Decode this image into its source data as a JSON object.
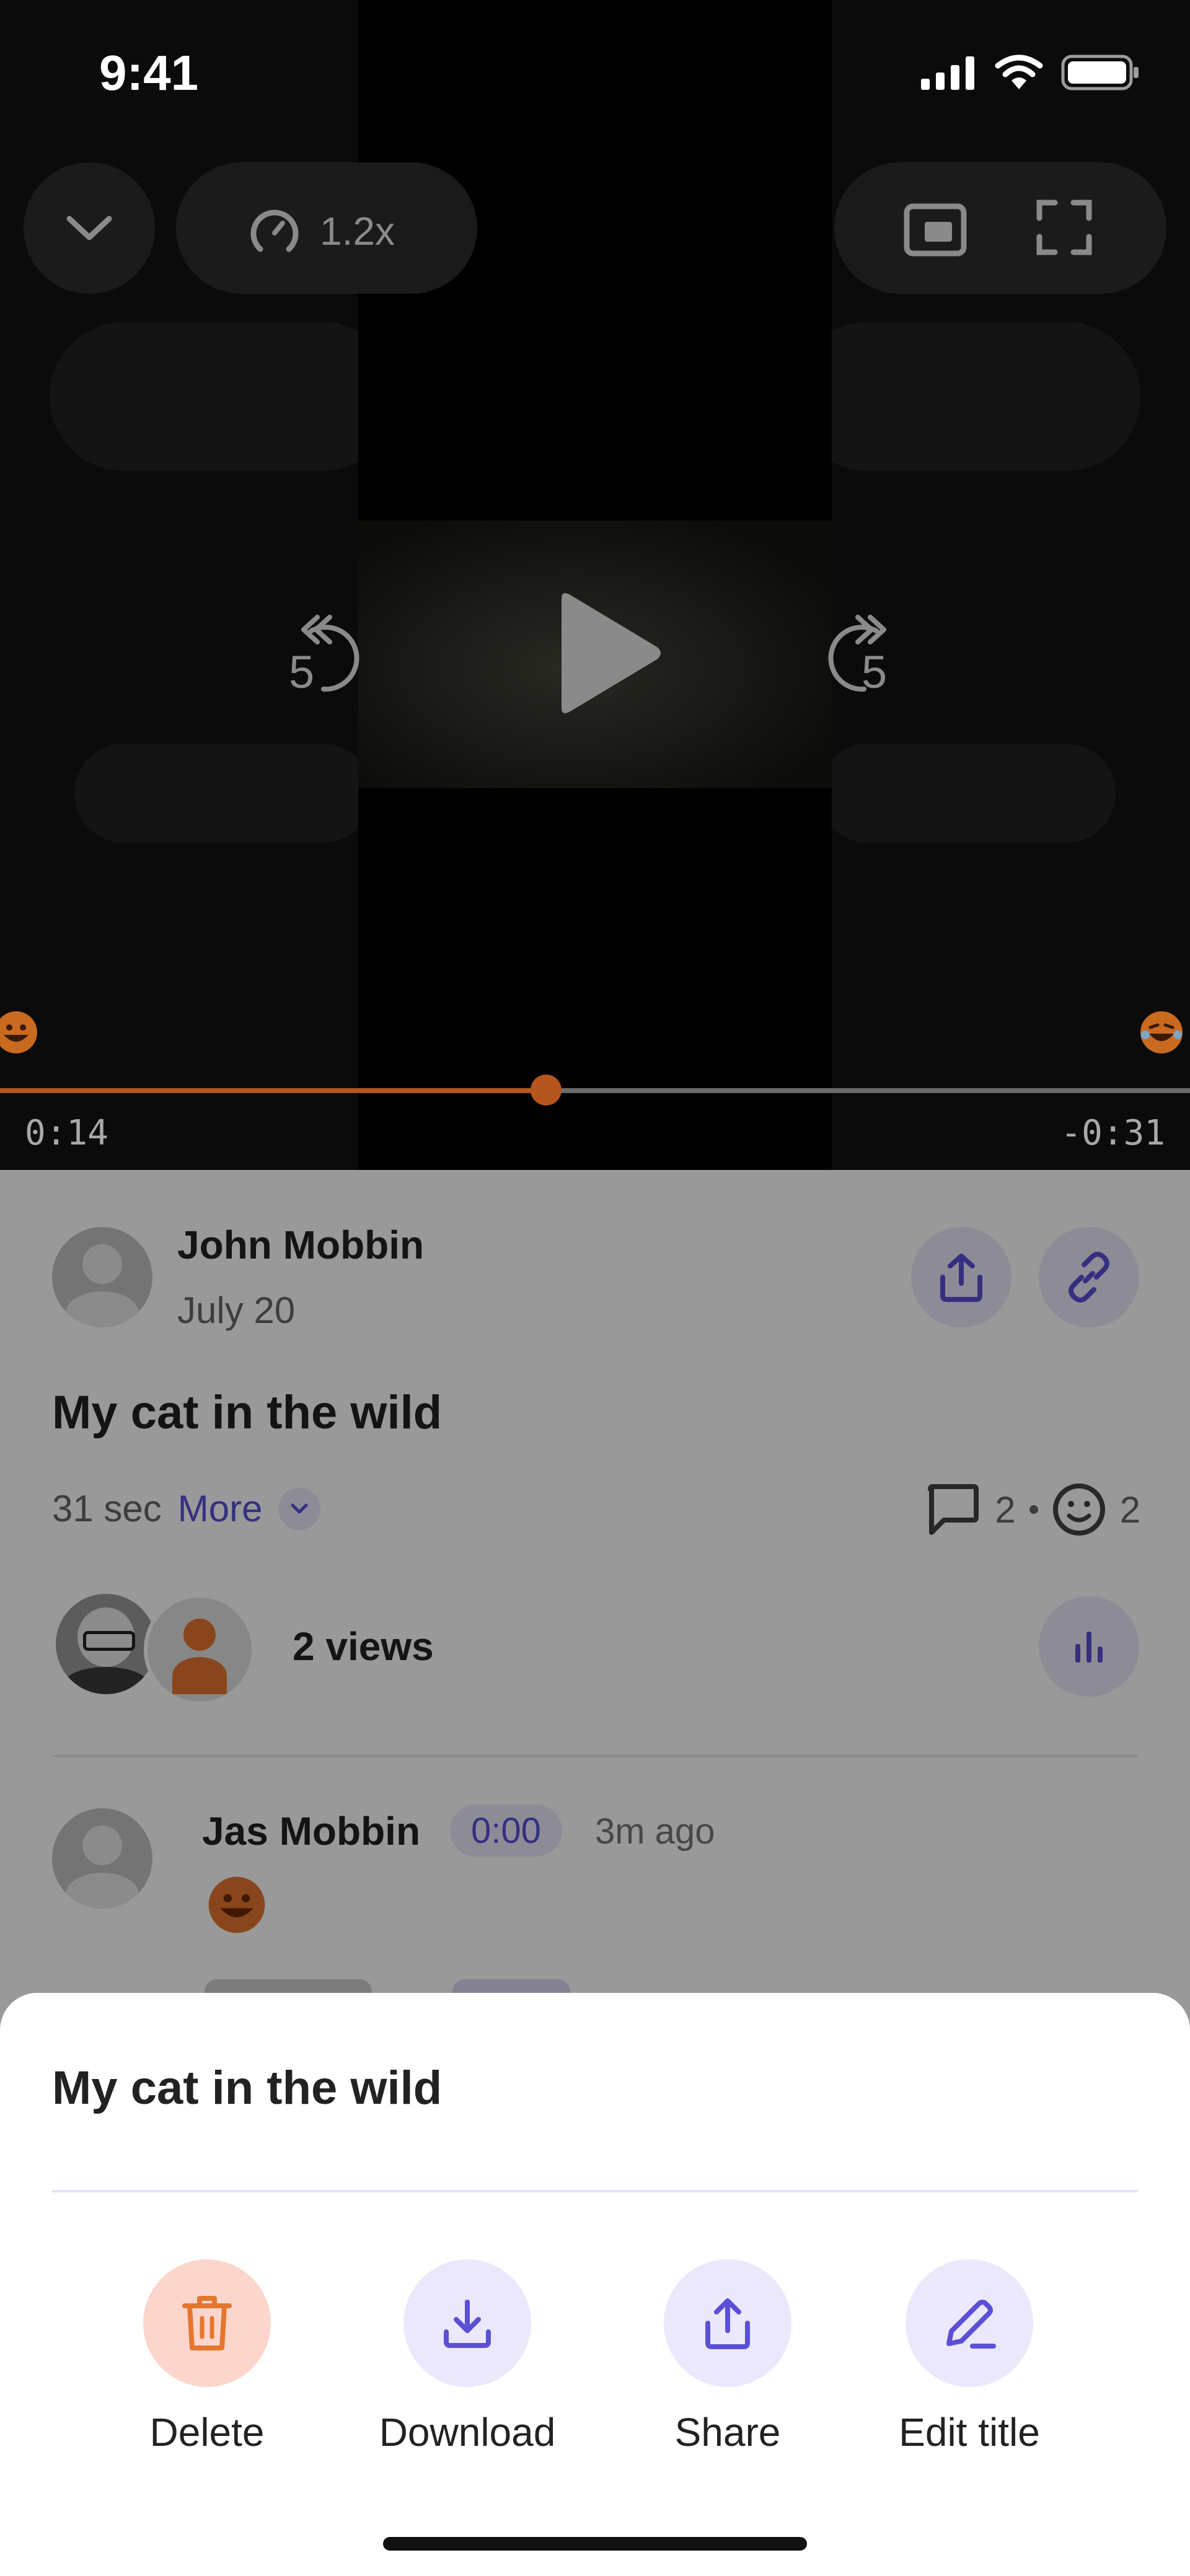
{
  "status_bar": {
    "time": "9:41",
    "icons": [
      "signal-icon",
      "wifi-icon",
      "battery-icon"
    ]
  },
  "player": {
    "playback_speed": "1.2x",
    "rewind_seconds": "5",
    "forward_seconds": "5",
    "elapsed": "0:14",
    "remaining": "-0:31",
    "progress_fraction": 0.46,
    "accent_color": "#b5561f"
  },
  "video_info": {
    "author": "John Mobbin",
    "date": "July 20",
    "title": "My cat in the wild",
    "duration": "31 sec",
    "more_label": "More",
    "comment_count": "2",
    "reaction_count": "2",
    "views_label": "2 views"
  },
  "comments": [
    {
      "author": "Jas Mobbin",
      "timestamp": "0:00",
      "ago": "3m ago",
      "reaction": "grinning-face"
    }
  ],
  "sheet": {
    "title": "My cat in the wild",
    "actions": [
      {
        "label": "Delete",
        "icon": "trash-icon",
        "color": "#e5762f"
      },
      {
        "label": "Download",
        "icon": "download-icon",
        "color": "#5b4fd6"
      },
      {
        "label": "Share",
        "icon": "share-icon",
        "color": "#5b4fd6"
      },
      {
        "label": "Edit title",
        "icon": "pencil-icon",
        "color": "#5b4fd6"
      }
    ]
  },
  "colors": {
    "brand_purple": "#5b4fd6",
    "purple_tint": "#ebe8fb",
    "danger_tint": "#fcd6cc"
  }
}
